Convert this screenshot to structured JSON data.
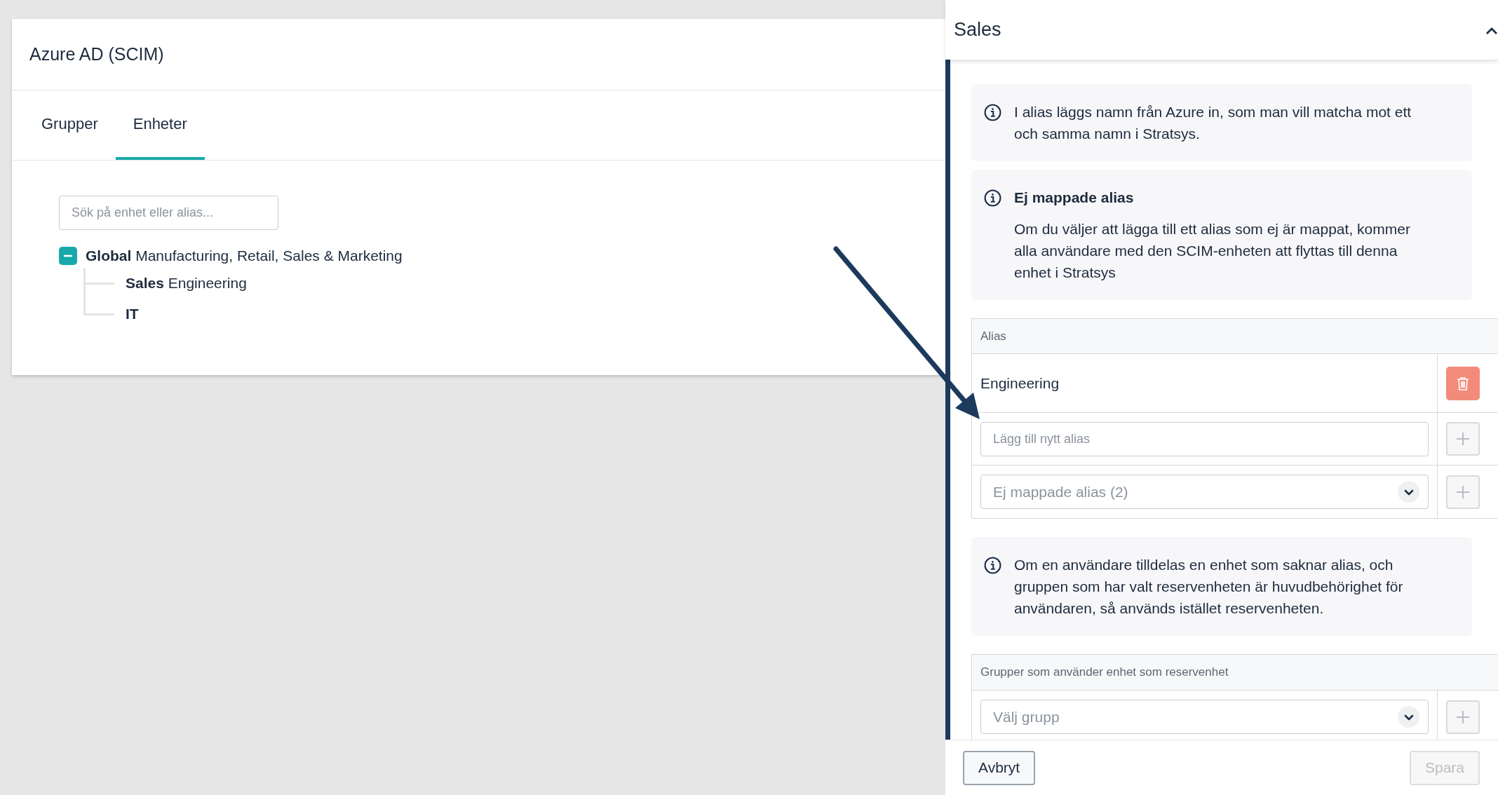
{
  "card": {
    "title": "Azure AD (SCIM)",
    "tabs": [
      {
        "label": "Grupper",
        "selected": false
      },
      {
        "label": "Enheter",
        "selected": true
      }
    ],
    "search": {
      "placeholder": "Sök på enhet eller alias..."
    },
    "tree": [
      {
        "label": "**Global** Manufacturing, Retail, Sales & Marketing",
        "expanded": true,
        "children": [
          {
            "label": "**Sales** Engineering"
          },
          {
            "label": "**IT**"
          }
        ]
      }
    ]
  },
  "panel": {
    "title": "Sales",
    "expanded": true,
    "sections": [
      {
        "kind": "info",
        "text": "I alias läggs namn från Azure in, som man vill matcha mot ett och samma namn i Stratsys."
      },
      {
        "kind": "info",
        "title": "Ej mappade alias",
        "text": "Om du väljer att lägga till ett alias som ej är mappat, kommer alla användare med den SCIM-enheten att flyttas till denna enhet i Stratsys"
      },
      {
        "kind": "alias_table",
        "header": "Alias",
        "aliases": [
          "Engineering"
        ],
        "new_alias": {
          "placeholder": "Lägg till nytt alias"
        },
        "unmapped_select": {
          "placeholder": "Ej mappade alias (2)"
        }
      },
      {
        "kind": "info",
        "text": "Om en användare tilldelas en enhet som saknar alias, och gruppen som har valt reservenheten är huvudbehörighet för användaren, så används istället reservenheten."
      },
      {
        "kind": "group_table",
        "header": "Grupper som använder enhet som reservenhet",
        "select": {
          "placeholder": "Välj grupp"
        }
      }
    ],
    "buttons": [
      {
        "label": "Avbryt",
        "disabled": false
      },
      {
        "label": "Spara",
        "disabled": true
      }
    ]
  }
}
